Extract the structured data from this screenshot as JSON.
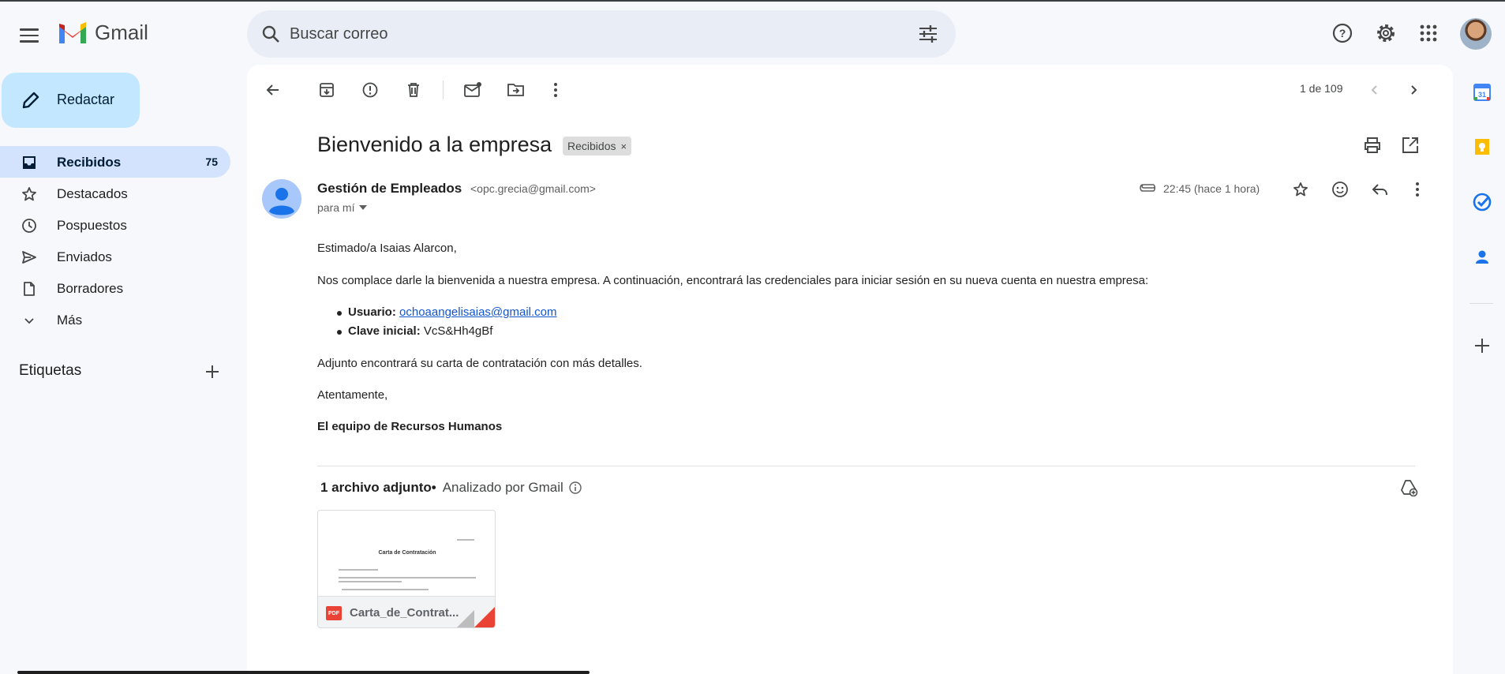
{
  "app": {
    "name": "Gmail"
  },
  "search": {
    "placeholder": "Buscar correo"
  },
  "compose": {
    "label": "Redactar"
  },
  "sidebar": {
    "items": [
      {
        "label": "Recibidos",
        "count": "75",
        "icon": "inbox-icon"
      },
      {
        "label": "Destacados",
        "icon": "star-icon"
      },
      {
        "label": "Pospuestos",
        "icon": "clock-icon"
      },
      {
        "label": "Enviados",
        "icon": "send-icon"
      },
      {
        "label": "Borradores",
        "icon": "draft-icon"
      },
      {
        "label": "Más",
        "icon": "chevron-down-icon"
      }
    ],
    "labels_title": "Etiquetas"
  },
  "toolbar": {
    "pager": "1 de 109"
  },
  "message": {
    "subject": "Bienvenido a la empresa",
    "label_chip": "Recibidos",
    "sender_name": "Gestión de Empleados",
    "sender_email": "<opc.grecia@gmail.com>",
    "recipient": "para mí",
    "time": "22:45 (hace 1 hora)",
    "greeting": "Estimado/a Isaias Alarcon,",
    "intro": "Nos complace darle la bienvenida a nuestra empresa. A continuación, encontrará las credenciales para iniciar sesión en su nueva cuenta en nuestra empresa:",
    "user_label": "Usuario:",
    "user_value": "ochoaangelisaias@gmail.com",
    "password_label": "Clave inicial:",
    "password_value": "VcS&Hh4gBf",
    "attachment_note": "Adjunto encontrará su carta de contratación con más detalles.",
    "closing": "Atentamente,",
    "signature": "El equipo de Recursos Humanos"
  },
  "attachments": {
    "header": "1 archivo adjunto",
    "separator": "•",
    "scanned": "Analizado por Gmail",
    "file_name": "Carta_de_Contrat...",
    "file_type": "PDF",
    "preview_title": "Carta de Contratación"
  },
  "colors": {
    "background": "#f6f8fc",
    "compose": "#c2e7ff",
    "active_nav": "#d3e3fd",
    "search": "#e9eef6",
    "link": "#1155cc",
    "pdf": "#ea4335"
  }
}
